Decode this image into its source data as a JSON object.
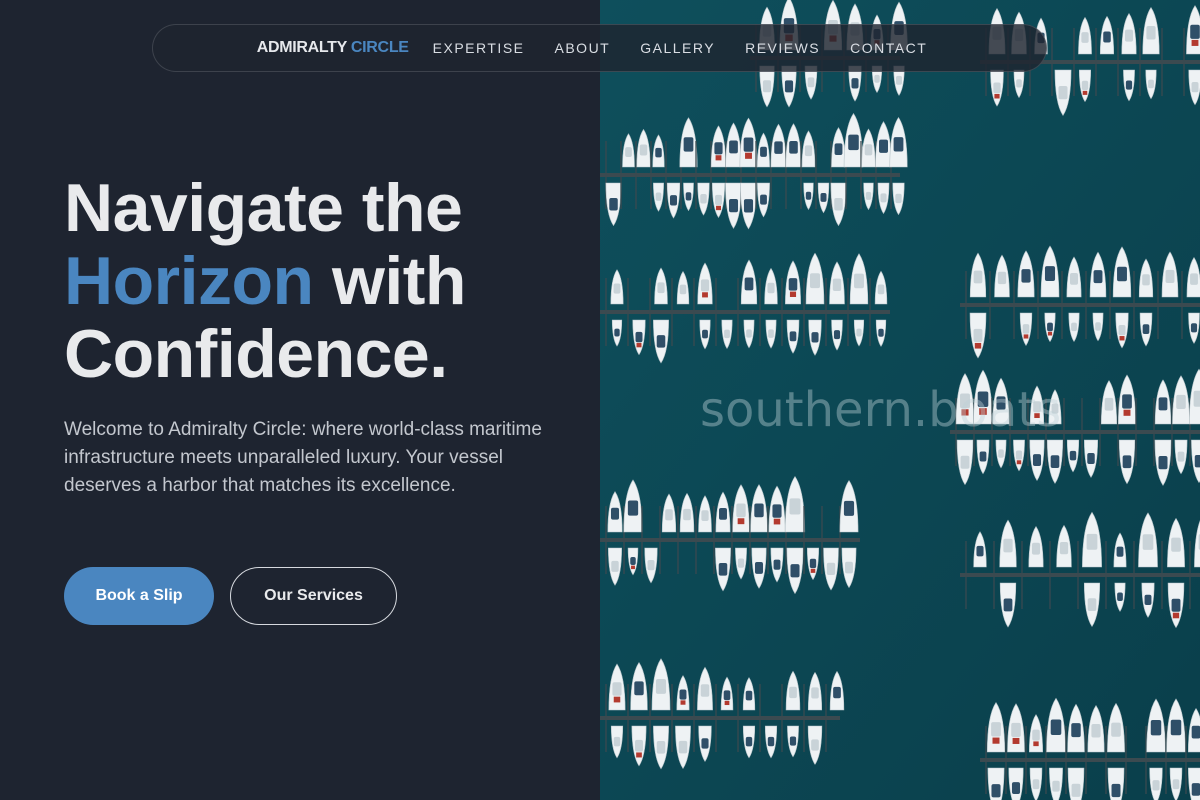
{
  "nav": {
    "brand_primary": "ADMIRALTY",
    "brand_accent": "CIRCLE",
    "links": [
      "EXPERTISE",
      "ABOUT",
      "GALLERY",
      "REVIEWS",
      "CONTACT"
    ]
  },
  "hero": {
    "title_line1": "Navigate the",
    "title_highlight": "Horizon",
    "title_line2_rest": " with",
    "title_line3": "Confidence.",
    "description": "Welcome to Admiralty Circle: where world-class maritime infrastructure meets unparalleled luxury. Your vessel deserves a harbor that matches its excellence.",
    "primary_button": "Book a Slip",
    "secondary_button": "Our Services"
  },
  "image": {
    "watermark": "southern.boats"
  },
  "colors": {
    "background": "#1e2430",
    "accent": "#4a86c0",
    "water": "#0d4a57"
  }
}
